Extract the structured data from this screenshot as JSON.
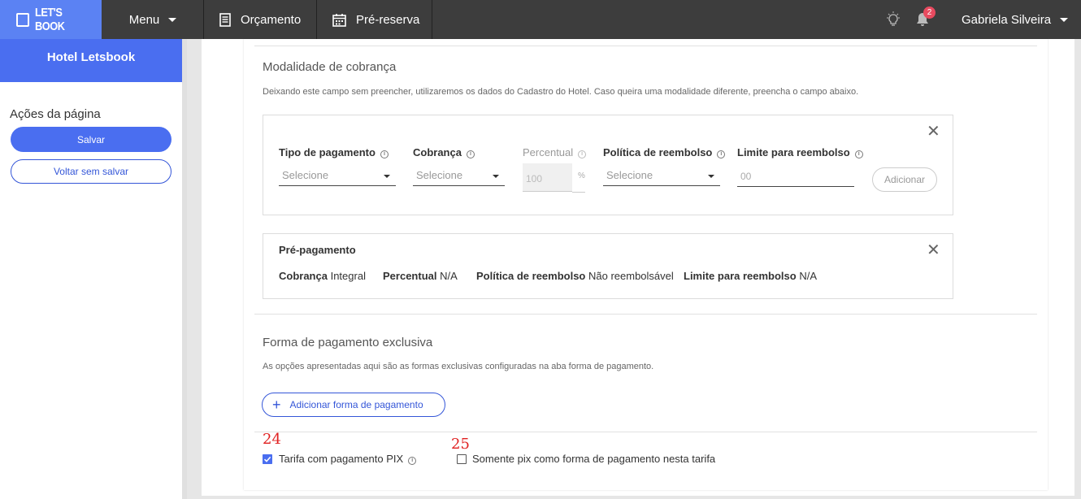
{
  "topbar": {
    "logo": "LET'S BOOK",
    "menu_label": "Menu",
    "nav": [
      {
        "label": "Orçamento",
        "icon": "document-icon"
      },
      {
        "label": "Pré-reserva",
        "icon": "calendar-icon"
      }
    ],
    "notification_count": "2",
    "user_name": "Gabriela Silveira"
  },
  "sidebar": {
    "hotel_name": "Hotel Letsbook",
    "actions_title": "Ações da página",
    "save_label": "Salvar",
    "back_label": "Voltar sem salvar"
  },
  "modalidade": {
    "title": "Modalidade de cobrança",
    "description": "Deixando este campo sem preencher, utilizaremos os dados do Cadastro do Hotel. Caso queira uma modalidade diferente, preencha o campo abaixo.",
    "form": {
      "tipo_label": "Tipo de pagamento",
      "tipo_placeholder": "Selecione",
      "cobranca_label": "Cobrança",
      "cobranca_placeholder": "Selecione",
      "percentual_label": "Percentual",
      "percentual_value": "100",
      "percentual_symbol": "%",
      "politica_label": "Política de reembolso",
      "politica_placeholder": "Selecione",
      "limite_label": "Limite para reembolso",
      "limite_value": "00",
      "add_label": "Adicionar"
    },
    "summary": {
      "title": "Pré-pagamento",
      "cobranca_label": "Cobrança",
      "cobranca_value": "Integral",
      "percentual_label": "Percentual",
      "percentual_value": "N/A",
      "politica_label": "Política de reembolso",
      "politica_value": "Não reembolsável",
      "limite_label": "Limite para reembolso",
      "limite_value": "N/A"
    }
  },
  "forma": {
    "title": "Forma de pagamento exclusiva",
    "description": "As opções apresentadas aqui são as formas exclusivas configuradas na aba forma de pagamento.",
    "add_label": "Adicionar forma de pagamento"
  },
  "markers": {
    "m24": "24",
    "m25": "25"
  },
  "checkboxes": {
    "pix_label": "Tarifa com pagamento PIX",
    "pix_checked": true,
    "somente_pix_label": "Somente pix como forma de pagamento nesta tarifa",
    "somente_pix_checked": false
  },
  "colors": {
    "primary": "#4a6ef0",
    "topbar": "#3d3d3d",
    "badge": "#e84a5f"
  }
}
